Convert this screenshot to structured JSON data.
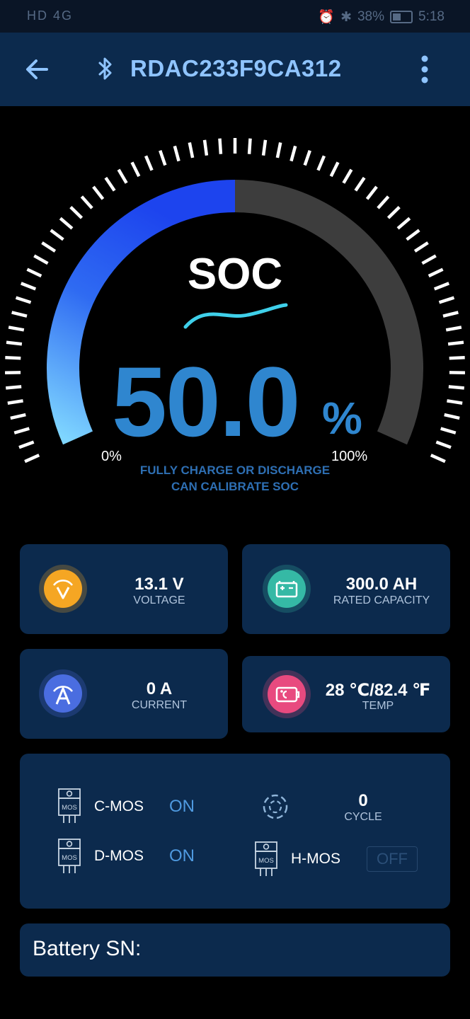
{
  "status_bar": {
    "left_indicators": "HD 4G",
    "battery_percent": "38%",
    "time": "5:18"
  },
  "header": {
    "device_name": "RDAC233F9CA312",
    "back_icon": "back-arrow-icon",
    "bluetooth_icon": "bluetooth-icon",
    "menu_icon": "more-vert-icon"
  },
  "gauge": {
    "title": "SOC",
    "value": "50.0",
    "unit": "%",
    "fraction": 0.5,
    "min_label": "0%",
    "max_label": "100%",
    "hint_line1": "FULLY CHARGE OR DISCHARGE",
    "hint_line2": "CAN CALIBRATE SOC",
    "fill_color": "#1f4ff0",
    "track_color": "#3d3d3d"
  },
  "metrics": [
    {
      "value": "13.1 V",
      "label": "VOLTAGE",
      "icon": "voltage-icon",
      "color": "#f5a623"
    },
    {
      "value": "300.0 AH",
      "label": "RATED CAPACITY",
      "icon": "battery-icon",
      "color": "#35b9a5"
    },
    {
      "value": "0 A",
      "label": "CURRENT",
      "icon": "current-icon",
      "color": "#4a6de0"
    },
    {
      "value": "28 ℃/82.4 ℉",
      "label": "TEMP",
      "icon": "temperature-icon",
      "color": "#e84a7f"
    }
  ],
  "mos": {
    "c_mos": {
      "label": "C-MOS",
      "state": "ON"
    },
    "d_mos": {
      "label": "D-MOS",
      "state": "ON"
    },
    "h_mos": {
      "label": "H-MOS",
      "state": "OFF"
    },
    "chip_text": "MOS",
    "cycle": {
      "value": "0",
      "label": "CYCLE"
    }
  },
  "battery_sn": {
    "label": "Battery SN:"
  }
}
